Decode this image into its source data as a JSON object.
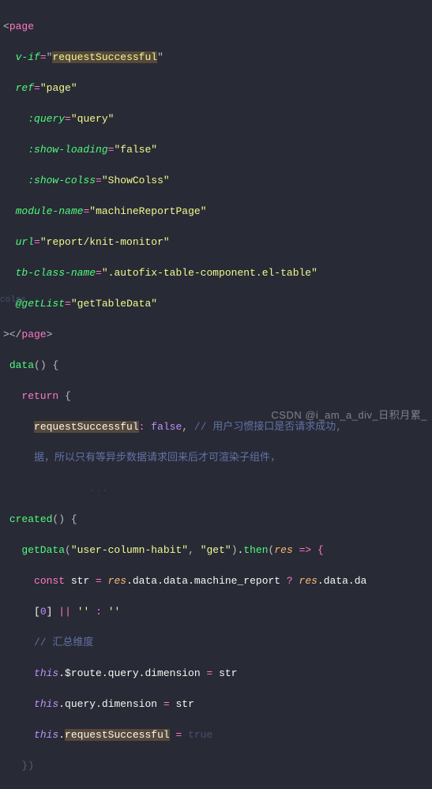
{
  "code": {
    "tag_open": "<",
    "tag_close": ">",
    "tag_end_open": "></",
    "tag_name": "page",
    "attrs": {
      "vif_name": "v-if",
      "vif_val": "requestSuccessful",
      "ref_name": "ref",
      "ref_val": "page",
      "query_name": ":query",
      "query_val": "query",
      "showloading_name": ":show-loading",
      "showloading_val": "false",
      "showcolss_name": ":show-colss",
      "showcolss_val": "ShowColss",
      "module_name": "module-name",
      "module_val": "machineReportPage",
      "url_name": "url",
      "url_val": "report/knit-monitor",
      "tbclass_name": "tb-class-name",
      "tbclass_val": ".autofix-table-component.el-table",
      "getlist_name": "@getList",
      "getlist_val": "getTableData"
    },
    "data_fn": "data",
    "return_kw": "return",
    "prop_name": "requestSuccessful",
    "prop_val": "false",
    "comment1": "// 用户习惯接口是否请求成功,",
    "comment1b": "据，所以只有等异步数据请求回来后才可渲染子组件，",
    "created_fn": "created",
    "getdata_fn": "getData",
    "getdata_arg1": "\"user-column-habit\"",
    "getdata_arg2": "\"get\"",
    "then_kw": ".then(",
    "res_param": "res",
    "arrow": " => {",
    "const_kw": "const",
    "str_var": "str",
    "eq": " = ",
    "res_path": "res.data.data.machine_report",
    "res_path_tail": "res.data.da",
    "qmark": " ? ",
    "fallback": "[0] || '' : ''",
    "comment2": "// 汇总维度",
    "this_kw": "this",
    "route_query": ".$route.query.dimension",
    "query_dim": ".query.dimension",
    "req_succ": ".requestSuccessful",
    "true_partial": "true"
  },
  "watermark": "CSDN @i_am_a_div_日积月累_",
  "gutter": "colss"
}
